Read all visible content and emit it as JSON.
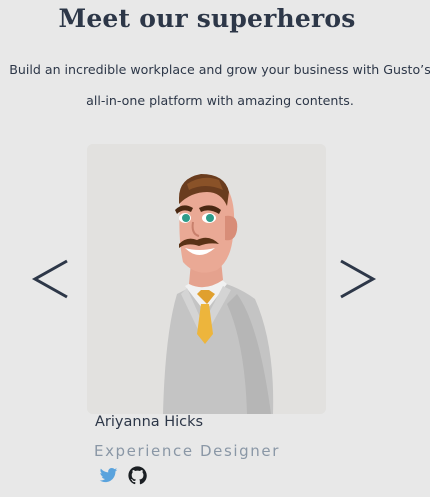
{
  "section": {
    "title": "Meet our superheros",
    "subtitle": "Build an incredible workplace and grow your business with Gusto’s all-in-one platform with amazing contents."
  },
  "carousel": {
    "prev_icon": "chevron-left-icon",
    "next_icon": "chevron-right-icon"
  },
  "member": {
    "name": "Ariyanna Hicks",
    "role": "Experience Designer",
    "avatar": "illustrated-man-portrait",
    "social": [
      {
        "icon": "twitter-icon",
        "color": "#5aa3dd"
      },
      {
        "icon": "github-icon",
        "color": "#1b1f23"
      }
    ]
  }
}
